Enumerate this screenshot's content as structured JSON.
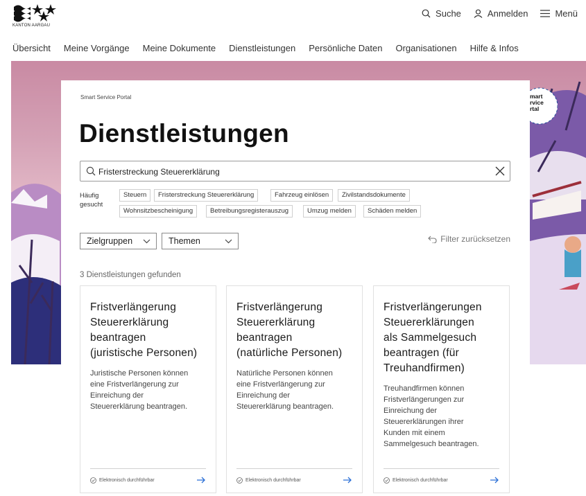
{
  "header": {
    "logo_text": "KANTON AARGAU",
    "search_label": "Suche",
    "login_label": "Anmelden",
    "menu_label": "Menü"
  },
  "nav": {
    "items": [
      "Übersicht",
      "Meine Vorgänge",
      "Meine Dokumente",
      "Dienstleistungen",
      "Persönliche Daten",
      "Organisationen",
      "Hilfe & Infos"
    ]
  },
  "badge": {
    "lines": [
      "mart",
      "rvice",
      "rtal"
    ]
  },
  "page": {
    "breadcrumb": "Smart Service Portal",
    "title": "Dienstleistungen",
    "search_value": "Fristerstreckung Steuererklärung",
    "freq_label_1": "Häufig",
    "freq_label_2": "gesucht",
    "chips": [
      "Steuern",
      "Fristerstreckung Steuererklärung",
      "Fahrzeug einlösen",
      "Zivilstandsdokumente",
      "Wohnsitzbescheinigung",
      "Betreibungsregisterauszug",
      "Umzug melden",
      "Schäden melden"
    ],
    "filter_groups": "Zielgruppen",
    "filter_topics": "Themen",
    "reset_filter": "Filter zurücksetzen",
    "results_count": "3 Dienstleistungen gefunden"
  },
  "results": [
    {
      "title_lines": [
        "Fristverlängerung",
        "Steuererklärung",
        "beantragen",
        "(juristische Personen)"
      ],
      "desc_lines": [
        "Juristische Personen können",
        "eine Fristverlängerung zur",
        "Einreichung der",
        "Steuererklärung beantragen."
      ],
      "status": "Elektronisch durchführbar"
    },
    {
      "title_lines": [
        "Fristverlängerung",
        "Steuererklärung",
        "beantragen",
        "(natürliche Personen)"
      ],
      "desc_lines": [
        "Natürliche Personen können",
        "eine Fristverlängerung zur",
        "Einreichung der",
        "Steuererklärung beantragen."
      ],
      "status": "Elektronisch durchführbar"
    },
    {
      "title_lines": [
        "Fristverlängerungen",
        "Steuererklärungen",
        "als Sammelgesuch",
        "beantragen (für",
        "Treuhandfirmen)"
      ],
      "desc_lines": [
        "Treuhandfirmen können",
        "Fristverlängerungen zur",
        "Einreichung der",
        "Steuererklärungen ihrer",
        "Kunden mit einem",
        "Sammelgesuch beantragen."
      ],
      "status": "Elektronisch durchführbar"
    }
  ],
  "colors": {
    "accent": "#2a6fd6",
    "hero_pink": "#d4a1b5"
  }
}
